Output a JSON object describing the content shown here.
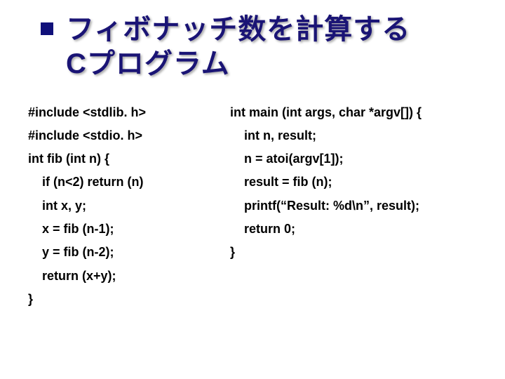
{
  "title": {
    "line1": "フィボナッチ数を計算する",
    "line2": "Cプログラム"
  },
  "left": {
    "l0": "#include <stdlib. h>",
    "l1": "#include <stdio. h>",
    "l2": "int fib (int n) {",
    "l3": "if (n<2) return (n)",
    "l4": "int x, y;",
    "l5": "x = fib (n-1);",
    "l6": "y = fib (n-2);",
    "l7": "return (x+y);",
    "l8": "}"
  },
  "right": {
    "r0": "int main (int args, char *argv[]) {",
    "r1": "int n, result;",
    "r2": "n = atoi(argv[1]);",
    "r3": "result = fib (n);",
    "r4": "printf(“Result: %d\\n”, result);",
    "r5": "return 0;",
    "r6": "}"
  }
}
